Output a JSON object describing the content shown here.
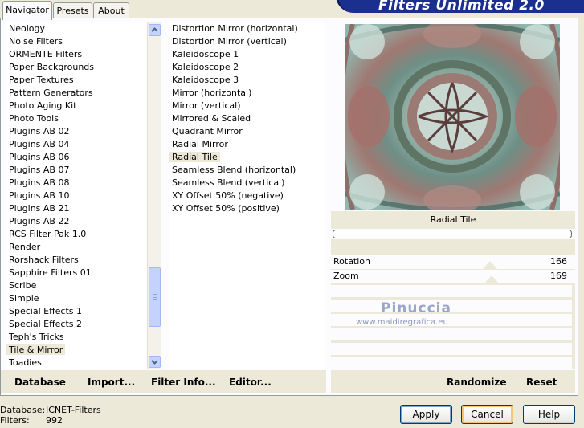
{
  "title": "Filters Unlimited 2.0",
  "tabs": [
    {
      "label": "Navigator"
    },
    {
      "label": "Presets"
    },
    {
      "label": "About"
    }
  ],
  "categories": [
    "Neology",
    "Noise Filters",
    "ORMENTE Filters",
    "Paper Backgrounds",
    "Paper Textures",
    "Pattern Generators",
    "Photo Aging Kit",
    "Photo Tools",
    "Plugins AB 02",
    "Plugins AB 04",
    "Plugins AB 06",
    "Plugins AB 07",
    "Plugins AB 08",
    "Plugins AB 10",
    "Plugins AB 21",
    "Plugins AB 22",
    "RCS Filter Pak 1.0",
    "Render",
    "Rorshack Filters",
    "Sapphire Filters 01",
    "Scribe",
    "Simple",
    "Special Effects 1",
    "Special Effects 2",
    "Teph's Tricks",
    "Tile & Mirror",
    "Toadies"
  ],
  "selected_category": "Tile & Mirror",
  "filters": [
    "Distortion Mirror (horizontal)",
    "Distortion Mirror (vertical)",
    "Kaleidoscope 1",
    "Kaleidoscope 2",
    "Kaleidoscope 3",
    "Mirror (horizontal)",
    "Mirror (vertical)",
    "Mirrored & Scaled",
    "Quadrant Mirror",
    "Radial Mirror",
    "Radial Tile",
    "Seamless Blend (horizontal)",
    "Seamless Blend (vertical)",
    "XY Offset 50% (negative)",
    "XY Offset 50% (positive)"
  ],
  "selected_filter": "Radial Tile",
  "toolbar": {
    "database_label": "Database",
    "import_label": "Import...",
    "filter_info_label": "Filter Info...",
    "editor_label": "Editor...",
    "randomize_label": "Randomize",
    "reset_label": "Reset"
  },
  "preview": {
    "filter_name": "Radial Tile",
    "watermark_name": "Pinuccia",
    "watermark_url": "www.maidiregrafica.eu"
  },
  "params": [
    {
      "label": "Rotation",
      "value": "166",
      "level": 0.651
    },
    {
      "label": "Zoom",
      "value": "169",
      "level": 0.663
    }
  ],
  "status": {
    "database_label": "Database:",
    "database_value": "ICNET-Filters",
    "filters_label": "Filters:",
    "filters_value": "992"
  },
  "buttons": {
    "apply": "Apply",
    "cancel": "Cancel",
    "help": "Help"
  },
  "colors": {
    "banner": "#1b2f8e",
    "tab_highlight": "#e68b2c",
    "window_bg": "#ece9d8"
  }
}
